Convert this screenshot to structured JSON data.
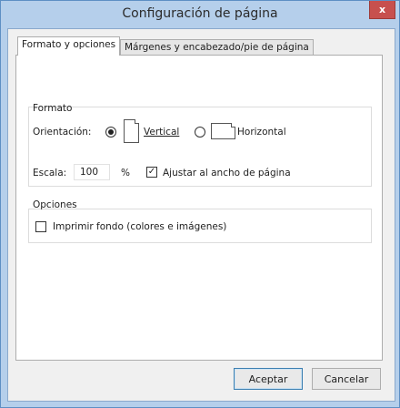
{
  "window": {
    "title": "Configuración de página",
    "close_glyph": "x"
  },
  "tabs": [
    {
      "label": "Formato y opciones",
      "active": true
    },
    {
      "label": "Márgenes y encabezado/pie de página",
      "active": false
    }
  ],
  "formato": {
    "group_title": "Formato",
    "orientation_label": "Orientación:",
    "vertical_label": "Vertical",
    "horizontal_label": "Horizontal",
    "selected_orientation": "Vertical",
    "scale_label": "Escala:",
    "scale_value": "100",
    "scale_unit": "%",
    "fit_width_label": "Ajustar al ancho de página",
    "fit_width_checked": true
  },
  "opciones": {
    "group_title": "Opciones",
    "print_background_label": "Imprimir fondo (colores e imágenes)",
    "print_background_checked": false
  },
  "buttons": {
    "accept": "Aceptar",
    "cancel": "Cancelar"
  },
  "colors": {
    "title_bar": "#b5cfeb",
    "close_button": "#c7504e",
    "panel_bg": "#f0f0f0"
  }
}
